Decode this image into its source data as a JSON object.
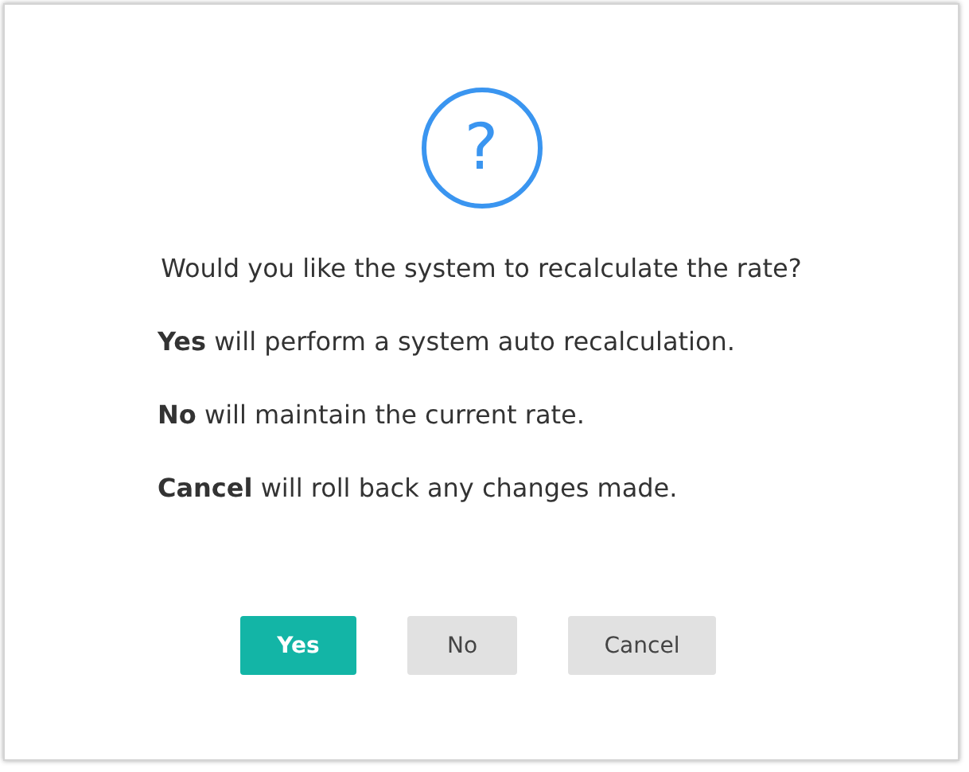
{
  "dialog": {
    "icon": "?",
    "question": "Would you like the system to recalculate the rate?",
    "explanations": [
      "**Yes** will perform a system auto recalculation.",
      "**No** will maintain the current rate.",
      "**Cancel** will roll back any changes made."
    ],
    "buttons": [
      {
        "label": "Yes",
        "kind": "primary"
      },
      {
        "label": "No",
        "kind": "secondary"
      },
      {
        "label": "Cancel",
        "kind": "secondary"
      }
    ]
  }
}
